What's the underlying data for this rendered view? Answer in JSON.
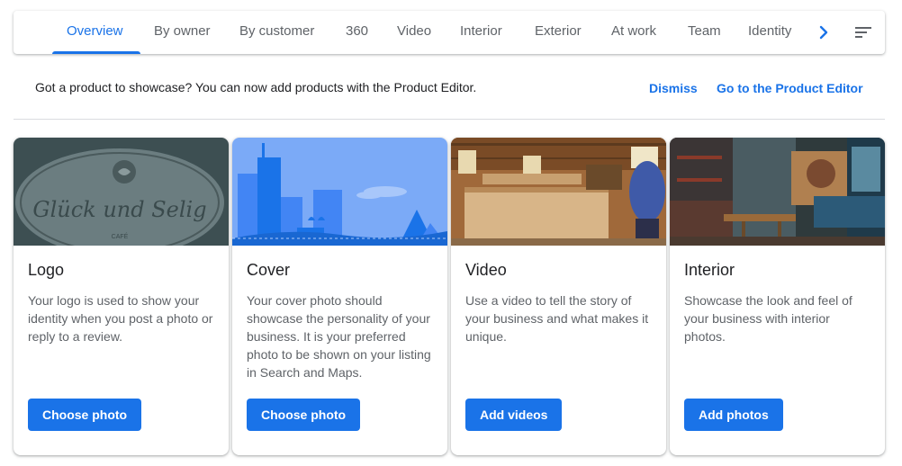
{
  "tabs": [
    {
      "label": "Overview",
      "active": true
    },
    {
      "label": "By owner"
    },
    {
      "label": "By customer"
    },
    {
      "label": "360"
    },
    {
      "label": "Video"
    },
    {
      "label": "Interior"
    },
    {
      "label": "Exterior"
    },
    {
      "label": "At work"
    },
    {
      "label": "Team"
    },
    {
      "label": "Identity"
    }
  ],
  "banner": {
    "text": "Got a product to showcase? You can now add products with the Product Editor.",
    "dismiss": "Dismiss",
    "go_to_editor": "Go to the Product Editor"
  },
  "cards": [
    {
      "title": "Logo",
      "description": "Your logo is used to show your identity when you post a photo or reply to a review.",
      "button": "Choose photo",
      "image_text": "Glück und Selig",
      "image_subtext": "CAFÉ"
    },
    {
      "title": "Cover",
      "description": "Your cover photo should showcase the personality of your business. It is your preferred photo to be shown on your listing in Search and Maps.",
      "button": "Choose photo"
    },
    {
      "title": "Video",
      "description": "Use a video to tell the story of your business and what makes it unique.",
      "button": "Add videos"
    },
    {
      "title": "Interior",
      "description": "Showcase the look and feel of your business with interior photos.",
      "button": "Add photos"
    }
  ],
  "colors": {
    "accent": "#1a73e8",
    "text_secondary": "#5f6368"
  },
  "icons": {
    "next": "chevron-right-icon",
    "filter": "sort-filter-icon"
  }
}
